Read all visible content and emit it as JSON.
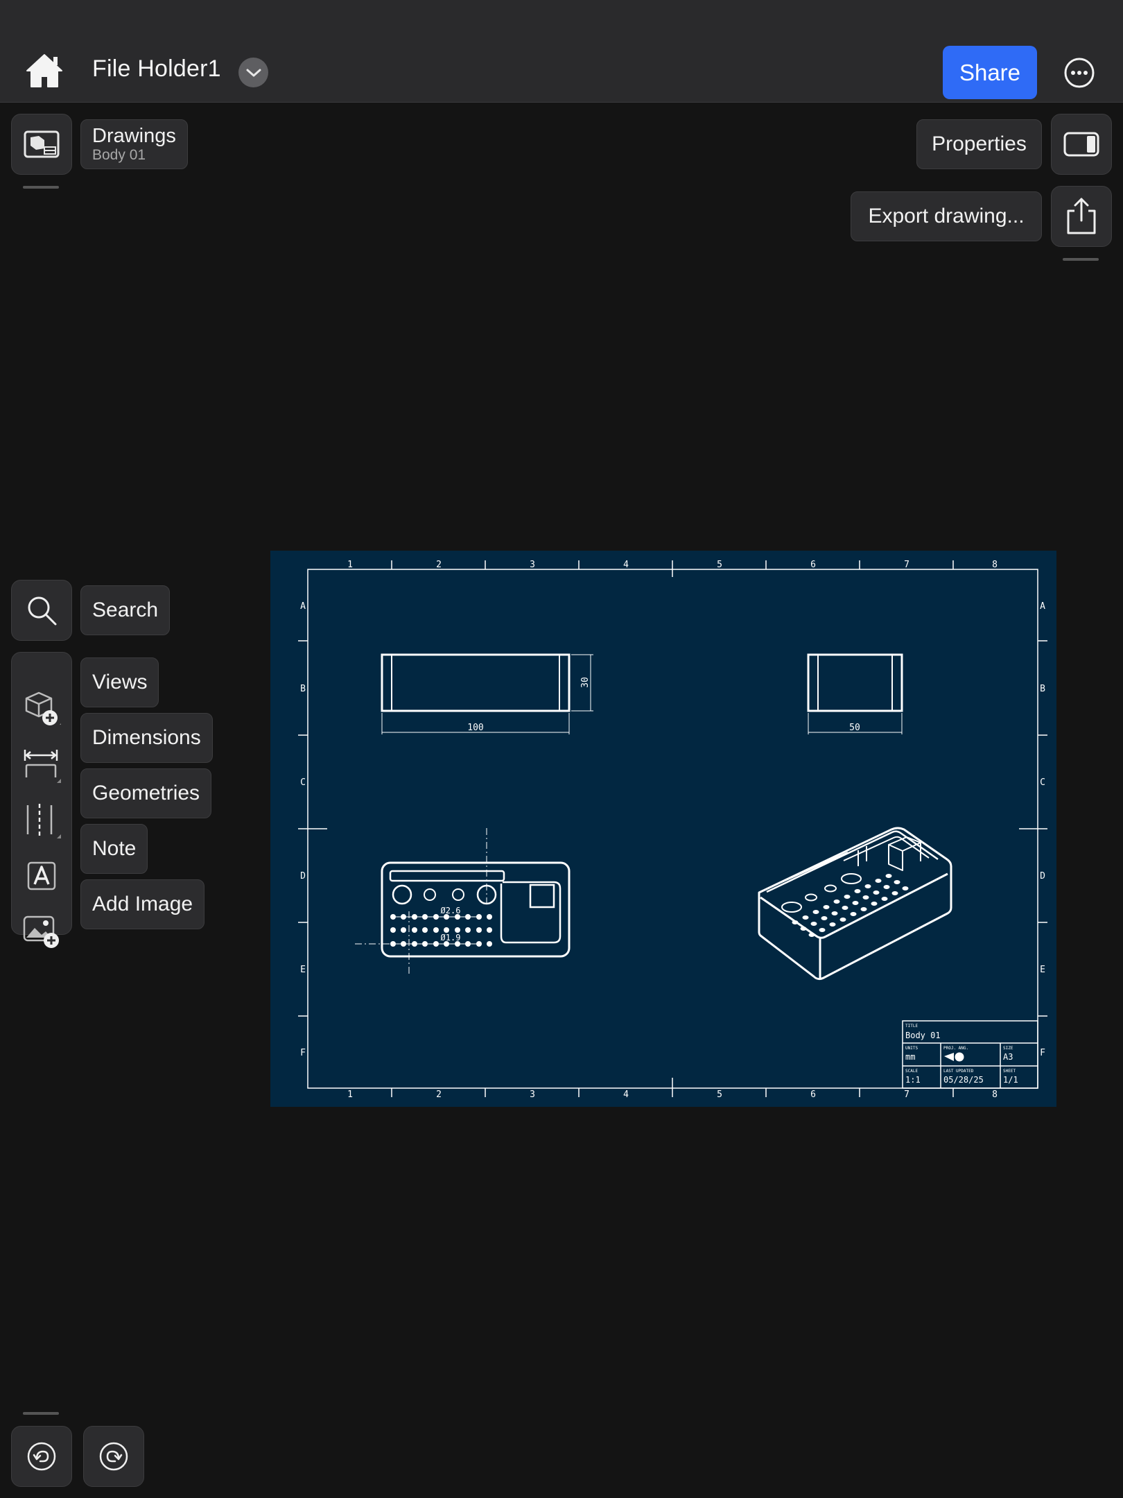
{
  "header": {
    "home_icon": "home-icon",
    "document_title": "File Holder1",
    "title_menu_icon": "chevron-down-icon",
    "share_label": "Share",
    "more_icon": "ellipsis-circle-icon"
  },
  "workspace": {
    "mode_label": "Drawings",
    "body_label": "Body 01",
    "properties_label": "Properties",
    "export_label": "Export drawing..."
  },
  "tools": {
    "search_label": "Search",
    "views_label": "Views",
    "dimensions_label": "Dimensions",
    "geometries_label": "Geometries",
    "note_label": "Note",
    "add_image_label": "Add Image"
  },
  "history": {
    "undo_icon": "undo-icon",
    "redo_icon": "redo-icon"
  },
  "drawing": {
    "background_color": "#022741",
    "column_labels": [
      "1",
      "2",
      "3",
      "4",
      "5",
      "6",
      "7",
      "8"
    ],
    "row_labels": [
      "A",
      "B",
      "C",
      "D",
      "E",
      "F"
    ],
    "dimensions": {
      "front_width": "100",
      "front_height": "30",
      "side_width": "50",
      "hole_large": "Ø2.6",
      "hole_small": "Ø1.9"
    },
    "title_block": {
      "title_caption": "TITLE",
      "title_value": "Body 01",
      "units_caption": "UNITS",
      "units_value": "mm",
      "projection_caption": "PROJ. ANG.",
      "size_caption": "SIZE",
      "size_value": "A3",
      "scale_caption": "SCALE",
      "scale_value": "1:1",
      "updated_caption": "LAST UPDATED",
      "updated_value": "05/28/25",
      "sheet_caption": "SHEET",
      "sheet_value": "1/1"
    }
  }
}
